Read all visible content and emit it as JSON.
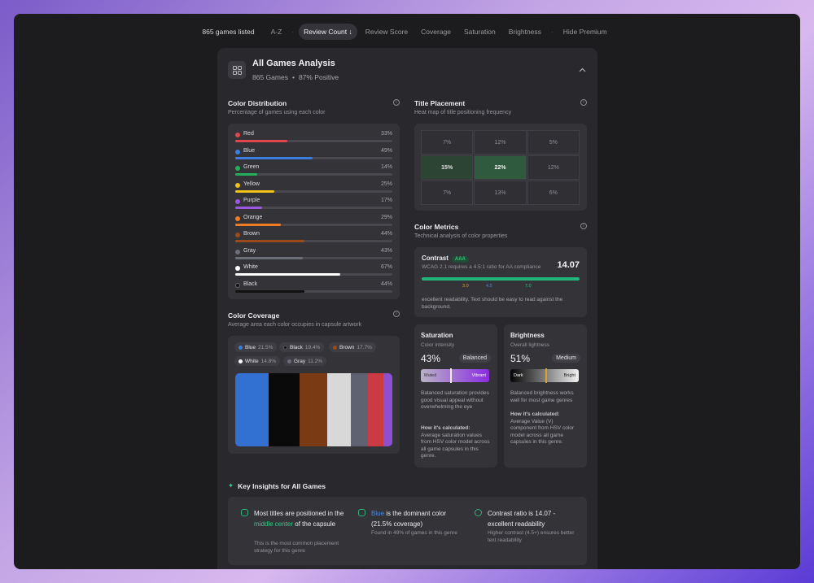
{
  "toolbar": {
    "count": "865 games listed",
    "sort_options": [
      "A-Z",
      "Review Count ↓",
      "Review Score",
      "Coverage",
      "Saturation",
      "Brightness",
      "Hide Premium"
    ],
    "active_sort": "Review Count ↓"
  },
  "panel": {
    "title": "All Games Analysis",
    "games": "865 Games",
    "positive": "87% Positive"
  },
  "color_distribution": {
    "title": "Color Distribution",
    "subtitle": "Percentage of games using each color",
    "items": [
      {
        "name": "Red",
        "pct": "33%",
        "value": 33,
        "color": "#e0474c"
      },
      {
        "name": "Blue",
        "pct": "49%",
        "value": 49,
        "color": "#3b7ee0"
      },
      {
        "name": "Green",
        "pct": "14%",
        "value": 14,
        "color": "#22b05a"
      },
      {
        "name": "Yellow",
        "pct": "25%",
        "value": 25,
        "color": "#f2c21b"
      },
      {
        "name": "Purple",
        "pct": "17%",
        "value": 17,
        "color": "#9b57e0"
      },
      {
        "name": "Orange",
        "pct": "29%",
        "value": 29,
        "color": "#f07a22"
      },
      {
        "name": "Brown",
        "pct": "44%",
        "value": 44,
        "color": "#9a4a1c"
      },
      {
        "name": "Gray",
        "pct": "43%",
        "value": 43,
        "color": "#6b6f7a"
      },
      {
        "name": "White",
        "pct": "67%",
        "value": 67,
        "color": "#ffffff"
      },
      {
        "name": "Black",
        "pct": "44%",
        "value": 44,
        "color": "#111111"
      }
    ]
  },
  "title_placement": {
    "title": "Title Placement",
    "subtitle": "Heat map of title positioning frequency",
    "cells": [
      "7%",
      "12%",
      "5%",
      "15%",
      "22%",
      "12%",
      "7%",
      "13%",
      "6%"
    ]
  },
  "color_coverage": {
    "title": "Color Coverage",
    "subtitle": "Average area each color occupies in capsule artwork",
    "chips": [
      {
        "name": "Blue",
        "pct": "21.5%",
        "color": "#3b7ee0"
      },
      {
        "name": "Black",
        "pct": "19.4%",
        "color": "#111111"
      },
      {
        "name": "Brown",
        "pct": "17.7%",
        "color": "#9a4a1c"
      },
      {
        "name": "White",
        "pct": "14.8%",
        "color": "#ffffff"
      },
      {
        "name": "Gray",
        "pct": "11.2%",
        "color": "#6b6f7a"
      }
    ],
    "segments": [
      {
        "name": "Blue",
        "value": 21.5,
        "color": "#3270d2"
      },
      {
        "name": "Black",
        "value": 19.4,
        "color": "#0a0a0a"
      },
      {
        "name": "Brown",
        "value": 17.7,
        "color": "#7a3a14"
      },
      {
        "name": "White",
        "value": 14.8,
        "color": "#d8d8d8"
      },
      {
        "name": "Gray",
        "value": 11.2,
        "color": "#5f6270"
      },
      {
        "name": "Red",
        "value": 9.5,
        "color": "#cc3a44"
      },
      {
        "name": "Purple",
        "value": 5.9,
        "color": "#8e4fd0"
      }
    ]
  },
  "color_metrics": {
    "title": "Color Metrics",
    "subtitle": "Technical analysis of color properties",
    "contrast": {
      "label": "Contrast",
      "badge": "AAA",
      "desc": "WCAG 2.1 requires a 4.5:1 ratio for AA compliance",
      "value": "14.07",
      "ticks": [
        "3.0",
        "4.5",
        "7.0"
      ],
      "note": "excellent readability. Text should be easy to read against the background."
    },
    "saturation": {
      "title": "Saturation",
      "sub": "Color intensity",
      "value": "43%",
      "level": 43,
      "tag": "Balanced",
      "left": "Muted",
      "right": "Vibrant",
      "desc": "Balanced saturation provides good visual appeal without overwhelming the eye",
      "how_title": "How it's calculated:",
      "how": "Average saturation values from HSV color model across all game capsules in this genre."
    },
    "brightness": {
      "title": "Brightness",
      "sub": "Overall lightness",
      "value": "51%",
      "level": 51,
      "tag": "Medium",
      "left": "Dark",
      "right": "Bright",
      "desc": "Balanced brightness works well for most game genres",
      "how_title": "How it's calculated:",
      "how": "Average Value (V) component from HSV color model across all game capsules in this genre."
    }
  },
  "insights": {
    "title": "Key Insights for All Games",
    "items": [
      {
        "pre": "Most titles are positioned in the ",
        "hl": "middle center",
        "post": " of the capsule",
        "sub": "This is the most common placement strategy for this genre"
      },
      {
        "pre": "",
        "hl": "Blue",
        "post": " is the dominant color (21.5% coverage)",
        "sub": "Found in 49% of games in this genre"
      },
      {
        "pre": "Contrast ratio is 14.07 - excellent readability",
        "hl": "",
        "post": "",
        "sub": "Higher contrast (4.5+) ensures better text readability"
      }
    ]
  }
}
